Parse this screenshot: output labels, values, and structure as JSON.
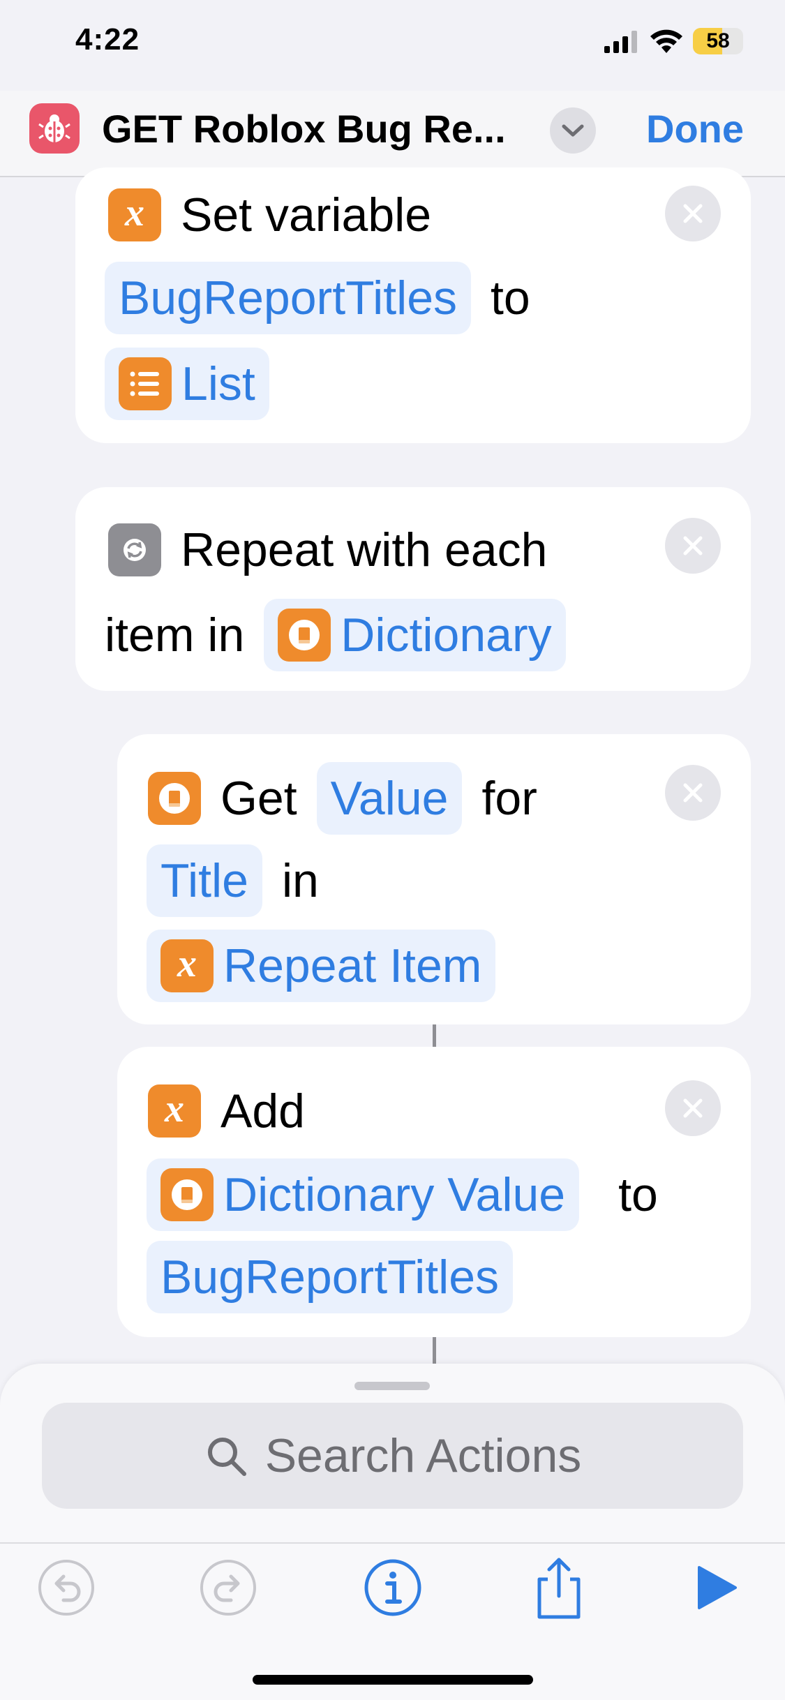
{
  "status_bar": {
    "time": "4:22",
    "battery": "58",
    "battery_level": 0.58
  },
  "nav": {
    "title": "GET Roblox Bug Re...",
    "done_label": "Done",
    "app_icon": "ladybug-icon",
    "menu_icon": "chevron-down-icon"
  },
  "actions": [
    {
      "verb": "Set variable",
      "var": "BugReportTitles",
      "to": "to",
      "value": "List",
      "icon": "variable-x-icon",
      "value_icon": "list-icon"
    },
    {
      "verb": "Repeat with each",
      "verb2": "item in",
      "value": "Dictionary",
      "icon": "repeat-icon",
      "value_icon": "dictionary-icon"
    },
    {
      "verb": "Get",
      "param": "Value",
      "for": "for",
      "key": "Title",
      "in": "in",
      "value": "Repeat Item",
      "icon": "dictionary-icon",
      "value_icon": "variable-x-icon"
    },
    {
      "verb": "Add",
      "value": "Dictionary Value",
      "to": "to",
      "target": "BugReportTitles",
      "icon": "variable-x-icon",
      "value_icon": "dictionary-icon"
    }
  ],
  "search": {
    "placeholder": "Search Actions",
    "icon": "search-icon"
  },
  "toolbar": {
    "items": [
      "undo-icon",
      "redo-icon",
      "info-icon",
      "share-icon",
      "play-icon"
    ]
  },
  "colors": {
    "accent": "#2f7de1",
    "variable_orange": "#ef8b2c",
    "app_icon": "#e9566a",
    "battery": "#f7ce46"
  }
}
